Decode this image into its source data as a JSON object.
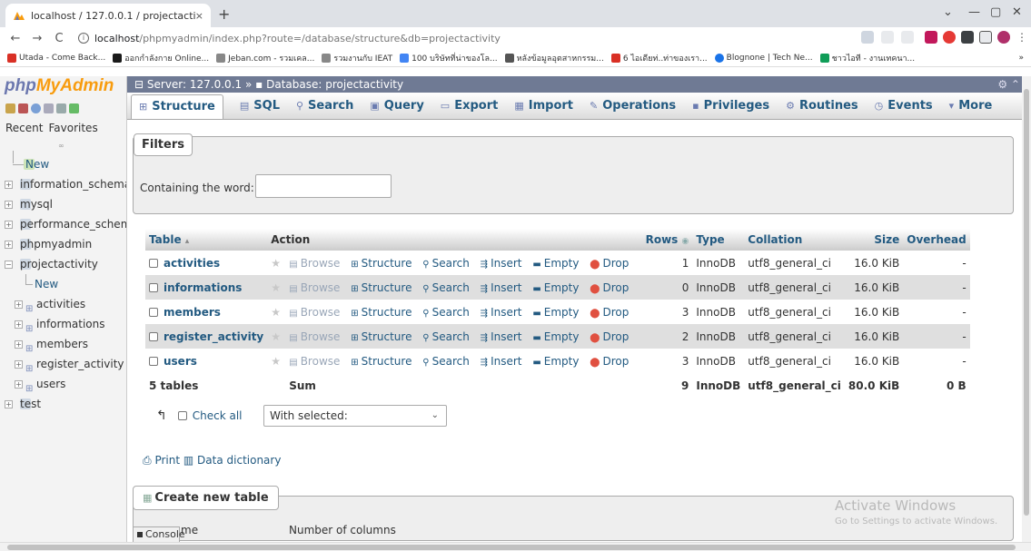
{
  "browser": {
    "tab_title": "localhost / 127.0.0.1 / projectacti",
    "tab_close": "×",
    "new_tab": "+",
    "win_dropdown": "⌄",
    "win_min": "—",
    "win_max": "▢",
    "win_close": "✕",
    "nav_back": "←",
    "nav_forward": "→",
    "nav_reload": "C",
    "url_host": "localhost",
    "url_rest": "/phpmyadmin/index.php?route=/database/structure&db=projectactivity",
    "bookmarks": [
      {
        "label": "Utada - Come Back...",
        "color": "#d93025"
      },
      {
        "label": "ออกกำลังกาย Online...",
        "color": "#1a1a1a"
      },
      {
        "label": "Jeban.com - รวมเคล...",
        "color": "#888888"
      },
      {
        "label": "รวมงานกับ IEAT",
        "color": "#888888"
      },
      {
        "label": "100 บริษัทที่น่าของโล...",
        "color": "#4285f4"
      },
      {
        "label": "หลังข้อมูลอุตสาหกรรม...",
        "color": "#555555"
      },
      {
        "label": "6 ไอเดียท่..ท่าของเรา...",
        "color": "#d93025"
      },
      {
        "label": "Blognone | Tech Ne...",
        "color": "#1a73e8"
      },
      {
        "label": "ชาวไอที - งานเทคนา...",
        "color": "#0f9d58"
      }
    ],
    "bookmarks_more": "»"
  },
  "pma": {
    "logo_php": "php",
    "logo_myadmin": "MyAdmin",
    "recent": "Recent",
    "favorites": "Favorites",
    "chain_icon": "∞",
    "tree": [
      {
        "label": "New",
        "level": 0,
        "kind": "new"
      },
      {
        "label": "information_schema",
        "level": 0,
        "kind": "db"
      },
      {
        "label": "mysql",
        "level": 0,
        "kind": "db"
      },
      {
        "label": "performance_schema",
        "level": 0,
        "kind": "db"
      },
      {
        "label": "phpmyadmin",
        "level": 0,
        "kind": "db"
      },
      {
        "label": "projectactivity",
        "level": 0,
        "kind": "db-open"
      },
      {
        "label": "New",
        "level": 1,
        "kind": "new"
      },
      {
        "label": "activities",
        "level": 1,
        "kind": "table"
      },
      {
        "label": "informations",
        "level": 1,
        "kind": "table"
      },
      {
        "label": "members",
        "level": 1,
        "kind": "table"
      },
      {
        "label": "register_activity",
        "level": 1,
        "kind": "table"
      },
      {
        "label": "users",
        "level": 1,
        "kind": "table"
      },
      {
        "label": "test",
        "level": 0,
        "kind": "db"
      }
    ],
    "server_label": "Server: 127.0.0.1",
    "breadcrumb_sep": "»",
    "database_label": "Database: projectactivity",
    "tabs": [
      "Structure",
      "SQL",
      "Search",
      "Query",
      "Export",
      "Import",
      "Operations",
      "Privileges",
      "Routines",
      "Events",
      "More"
    ],
    "filters": {
      "legend": "Filters",
      "label": "Containing the word:",
      "value": ""
    },
    "table_headers": {
      "table": "Table",
      "sort_arrow": "▴",
      "action": "Action",
      "rows": "Rows",
      "rows_icon": "◉",
      "type": "Type",
      "collation": "Collation",
      "size": "Size",
      "overhead": "Overhead"
    },
    "actions": [
      "Browse",
      "Structure",
      "Search",
      "Insert",
      "Empty",
      "Drop"
    ],
    "rows": [
      {
        "name": "activities",
        "rows": "1",
        "type": "InnoDB",
        "collation": "utf8_general_ci",
        "size": "16.0 KiB",
        "overhead": "-"
      },
      {
        "name": "informations",
        "rows": "0",
        "type": "InnoDB",
        "collation": "utf8_general_ci",
        "size": "16.0 KiB",
        "overhead": "-"
      },
      {
        "name": "members",
        "rows": "3",
        "type": "InnoDB",
        "collation": "utf8_general_ci",
        "size": "16.0 KiB",
        "overhead": "-"
      },
      {
        "name": "register_activity",
        "rows": "2",
        "type": "InnoDB",
        "collation": "utf8_general_ci",
        "size": "16.0 KiB",
        "overhead": "-"
      },
      {
        "name": "users",
        "rows": "3",
        "type": "InnoDB",
        "collation": "utf8_general_ci",
        "size": "16.0 KiB",
        "overhead": "-"
      }
    ],
    "summary": {
      "tables": "5 tables",
      "sum": "Sum",
      "rows": "9",
      "type": "InnoDB",
      "collation": "utf8_general_ci",
      "size": "80.0 KiB",
      "overhead": "0 B"
    },
    "check_all": "Check all",
    "with_selected": "With selected:",
    "print": "Print",
    "data_dictionary": "Data dictionary",
    "create_table": "Create new table",
    "name_label": "me",
    "number_of_columns": "Number of columns",
    "console": "Console",
    "watermark_title": "Activate Windows",
    "watermark_sub": "Go to Settings to activate Windows."
  }
}
